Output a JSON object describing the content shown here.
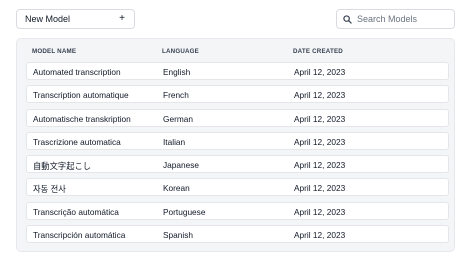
{
  "toolbar": {
    "new_model_label": "New Model",
    "new_model_icon": "plus-icon",
    "search_placeholder": "Search Models",
    "search_icon": "search-icon"
  },
  "table": {
    "headers": {
      "name": "MODEL NAME",
      "language": "LANGUAGE",
      "date": "DATE CREATED"
    },
    "rows": [
      {
        "name": "Automated transcription",
        "language": "English",
        "date": "April 12, 2023"
      },
      {
        "name": "Transcription automatique",
        "language": "French",
        "date": "April 12, 2023"
      },
      {
        "name": "Automatische transkription",
        "language": "German",
        "date": "April 12, 2023"
      },
      {
        "name": "Trascrizione automatica",
        "language": "Italian",
        "date": "April 12, 2023"
      },
      {
        "name": "自動文字起こし",
        "language": "Japanese",
        "date": "April 12, 2023"
      },
      {
        "name": "자동 전사",
        "language": "Korean",
        "date": "April 12, 2023"
      },
      {
        "name": "Transcrição automática",
        "language": "Portuguese",
        "date": "April 12, 2023"
      },
      {
        "name": "Transcripción automática",
        "language": "Spanish",
        "date": "April 12, 2023"
      }
    ]
  }
}
